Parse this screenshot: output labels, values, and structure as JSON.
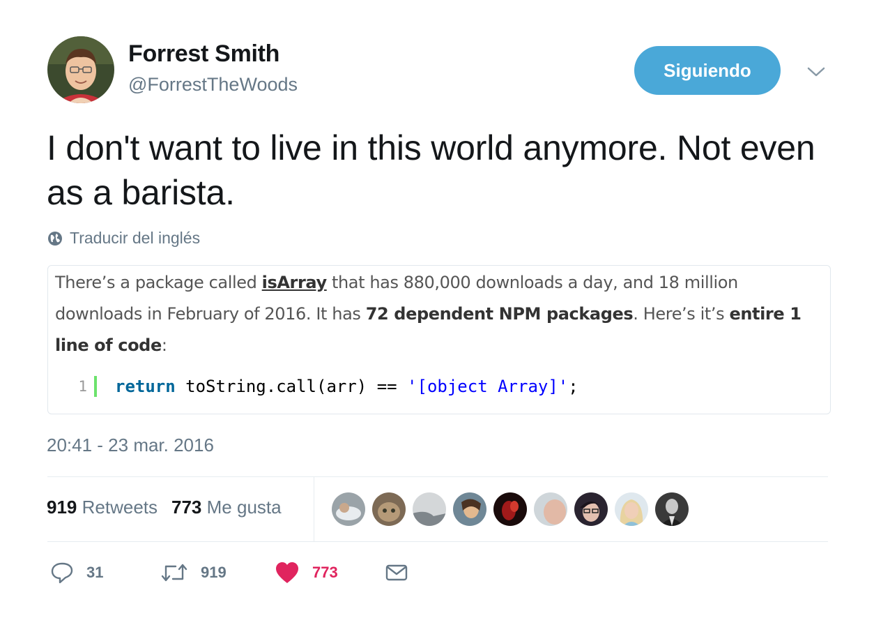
{
  "user": {
    "name": "Forrest Smith",
    "handle": "@ForrestTheWoods",
    "follow_label": "Siguiendo"
  },
  "tweet": {
    "text": "I don't want to live in this world anymore. Not even as a barista.",
    "translate_label": "Traducir del inglés",
    "timestamp": "20:41 - 23 mar. 2016"
  },
  "media": {
    "t1": "There’s a package called ",
    "pkg": "isArray",
    "t2": " that has 880,000 downloads a day, and 18 million downloads in February of 2016. It has ",
    "b1": "72 dependent NPM packages",
    "t3": ". Here’s it’s ",
    "b2": "entire 1 line of code",
    "t4": ":",
    "code": {
      "line_number": "1",
      "keyword": "return",
      "expr": " toString.call(arr) == ",
      "string": "'[object Array]'",
      "end": ";"
    }
  },
  "stats": {
    "retweets_count": "919",
    "retweets_label": "Retweets",
    "likes_count": "773",
    "likes_label": "Me gusta"
  },
  "actions": {
    "reply_count": "31",
    "retweet_count": "919",
    "like_count": "773"
  },
  "colors": {
    "follow_button": "#4aa8d8",
    "like_active": "#e0245e",
    "muted": "#657786"
  }
}
